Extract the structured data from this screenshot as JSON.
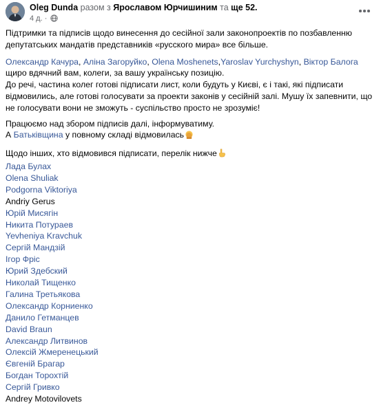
{
  "author": {
    "name": "Oleg Dunda",
    "with_text": "разом з",
    "tagged": "Ярославом Юрчишиним",
    "and_text": "та",
    "others": "ще 52.",
    "time": "4 д.",
    "privacy_icon": "globe-icon"
  },
  "post": {
    "para1": "Підтримки та підписів щодо винесення до сесійної зали законопроектів по позбавленню депутатських мандатів представників «русского мира» все більше.",
    "thanks_names": [
      "Олександр Качура",
      "Аліна Загоруйко",
      "Olena Moshenets",
      "Yaroslav Yurchyshyn",
      "Віктор Балога"
    ],
    "thanks_tail": "щиро вдячний вам, колеги, за вашу українську позицію.",
    "para3": "До речі, частина колег готові підписати лист, коли будуть у Києві, є і такі, які підписати відмовились, але готові голосувати за проекти законів у сесійній залі. Мушу їх запевнити, що не  голосувати вони не зможуть - суспільство просто не зрозуміє!",
    "para4_line1": "Працюємо над збором підписів далі, інформуватиму.",
    "para4_prefix": "А ",
    "batkivshchyna": "Батьківщина",
    "para4_suffix": " у повному складі відмовилась",
    "list_intro": "Щодо інших, хто відмовився підписати, перелік нижче",
    "refused": [
      {
        "name": "Лада Булах",
        "linked": true
      },
      {
        "name": "Olena Shuliak",
        "linked": true
      },
      {
        "name": "Podgorna Viktoriya",
        "linked": true
      },
      {
        "name": "Andriy Gerus",
        "linked": false
      },
      {
        "name": "Юрій Мисягін",
        "linked": true
      },
      {
        "name": "Никита Потураев",
        "linked": true
      },
      {
        "name": "Yevheniya Kravchuk",
        "linked": true
      },
      {
        "name": "Сергій Мандзій",
        "linked": true
      },
      {
        "name": "Ігор Фріс",
        "linked": true
      },
      {
        "name": "Юрий Здебский",
        "linked": true
      },
      {
        "name": "Николай Тищенко",
        "linked": true
      },
      {
        "name": "Галина Третьякова",
        "linked": true
      },
      {
        "name": "Олександр Корниенко",
        "linked": true
      },
      {
        "name": "Данило Гетманцев",
        "linked": true
      },
      {
        "name": "David Braun",
        "linked": true
      },
      {
        "name": "Александр Литвинов",
        "linked": true
      },
      {
        "name": "Олексій Жмеренецький",
        "linked": true
      },
      {
        "name": "Євгеній Брагар",
        "linked": true
      },
      {
        "name": "Богдан Торохтій",
        "linked": true
      },
      {
        "name": "Сергій Гривко",
        "linked": true
      },
      {
        "name": "Andrey  Motovilovets",
        "linked": false
      }
    ]
  },
  "colors": {
    "link": "#385898",
    "text": "#050505",
    "muted": "#65676b"
  }
}
